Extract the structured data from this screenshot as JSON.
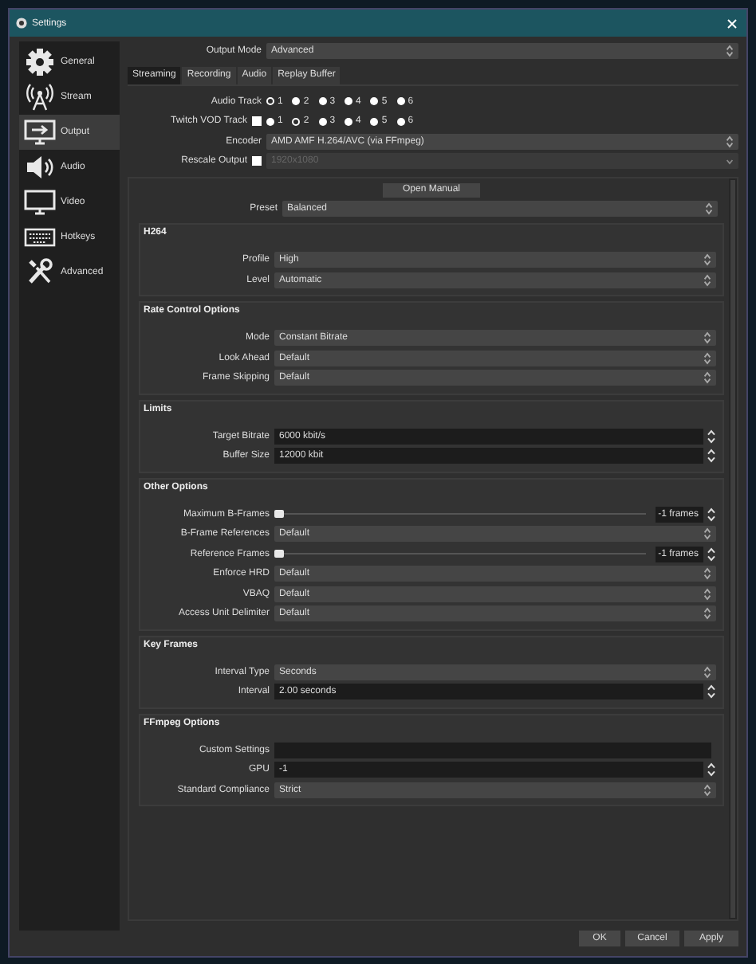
{
  "window": {
    "title": "Settings"
  },
  "sidebar": {
    "items": [
      {
        "label": "General",
        "kind": "gear",
        "selected": false
      },
      {
        "label": "Stream",
        "kind": "tower",
        "selected": false
      },
      {
        "label": "Output",
        "kind": "output",
        "selected": true
      },
      {
        "label": "Audio",
        "kind": "speaker",
        "selected": false
      },
      {
        "label": "Video",
        "kind": "monitor",
        "selected": false
      },
      {
        "label": "Hotkeys",
        "kind": "keyboard",
        "selected": false
      },
      {
        "label": "Advanced",
        "kind": "tools",
        "selected": false
      }
    ]
  },
  "output_mode": {
    "label": "Output Mode",
    "value": "Advanced"
  },
  "tabs": [
    {
      "label": "Streaming",
      "selected": true
    },
    {
      "label": "Recording",
      "selected": false
    },
    {
      "label": "Audio",
      "selected": false
    },
    {
      "label": "Replay Buffer",
      "selected": false
    }
  ],
  "track_rows": [
    {
      "label": "Audio Track",
      "options": [
        {
          "label": "1",
          "selected": true
        },
        {
          "label": "2",
          "selected": false
        },
        {
          "label": "3",
          "selected": false
        },
        {
          "label": "4",
          "selected": false
        },
        {
          "label": "5",
          "selected": false
        },
        {
          "label": "6",
          "selected": false
        }
      ]
    },
    {
      "label": "Twitch VOD Track",
      "checked": false,
      "options": [
        {
          "label": "1",
          "selected": false
        },
        {
          "label": "2",
          "selected": true
        },
        {
          "label": "3",
          "selected": false
        },
        {
          "label": "4",
          "selected": false
        },
        {
          "label": "5",
          "selected": false
        },
        {
          "label": "6",
          "selected": false
        }
      ]
    }
  ],
  "encoder": {
    "label": "Encoder",
    "value": "AMD AMF H.264/AVC (via FFmpeg)"
  },
  "rescale": {
    "label": "Rescale Output",
    "checked": false,
    "disabled": true,
    "value": "1920x1080"
  },
  "open_manual_button": "Open Manual",
  "preset": {
    "label": "Preset",
    "value": "Balanced"
  },
  "groups": [
    {
      "title": "H264",
      "fields": [
        {
          "label": "Profile",
          "kind": "dropdown",
          "value": "High"
        },
        {
          "label": "Level",
          "kind": "dropdown",
          "value": "Automatic"
        }
      ]
    },
    {
      "title": "Rate Control Options",
      "fields": [
        {
          "label": "Mode",
          "kind": "dropdown",
          "value": "Constant Bitrate"
        },
        {
          "label": "Look Ahead",
          "kind": "dropdown",
          "value": "Default"
        },
        {
          "label": "Frame Skipping",
          "kind": "dropdown",
          "value": "Default"
        }
      ]
    },
    {
      "title": "Limits",
      "fields": [
        {
          "label": "Target Bitrate",
          "kind": "spin",
          "value": "6000 kbit/s"
        },
        {
          "label": "Buffer Size",
          "kind": "spin",
          "value": "12000 kbit"
        }
      ]
    },
    {
      "title": "Other Options",
      "fields": [
        {
          "label": "Maximum B-Frames",
          "kind": "slider",
          "level": 0,
          "value": "-1 frames"
        },
        {
          "label": "B-Frame References",
          "kind": "dropdown",
          "value": "Default"
        },
        {
          "label": "Reference Frames",
          "kind": "slider",
          "level": 0,
          "value": "-1 frames"
        },
        {
          "label": "Enforce HRD",
          "kind": "dropdown",
          "value": "Default"
        },
        {
          "label": "VBAQ",
          "kind": "dropdown",
          "value": "Default"
        },
        {
          "label": "Access Unit Delimiter",
          "kind": "dropdown",
          "value": "Default"
        }
      ]
    },
    {
      "title": "Key Frames",
      "fields": [
        {
          "label": "Interval Type",
          "kind": "dropdown",
          "value": "Seconds"
        },
        {
          "label": "Interval",
          "kind": "spin",
          "value": "2.00 seconds"
        }
      ]
    },
    {
      "title": "FFmpeg Options",
      "fields": [
        {
          "label": "Custom Settings",
          "kind": "text"
        },
        {
          "label": "GPU",
          "kind": "spin",
          "value": "-1"
        },
        {
          "label": "Standard Compliance",
          "kind": "dropdown",
          "value": "Strict"
        }
      ]
    }
  ],
  "buttons": [
    "OK",
    "Cancel",
    "Apply"
  ]
}
